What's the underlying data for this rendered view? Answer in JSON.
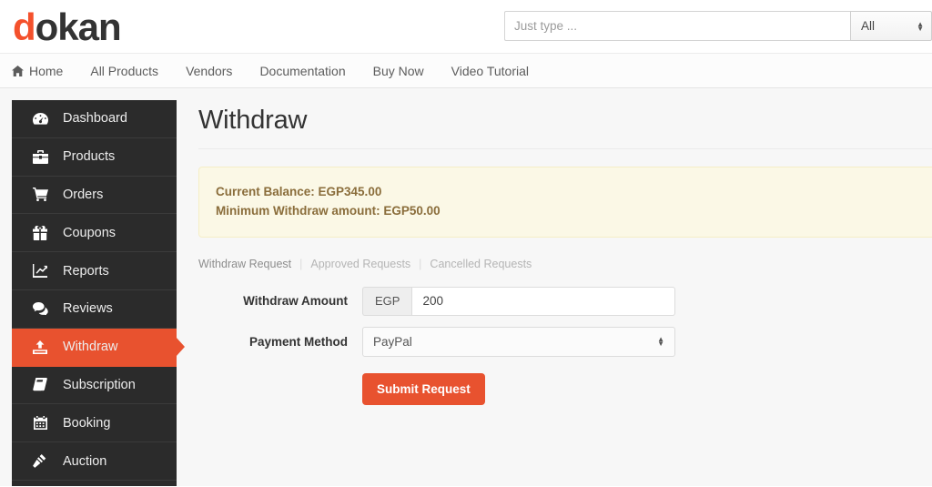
{
  "brand": {
    "logo_first": "d",
    "logo_rest": "okan",
    "accent_color": "#e8522f",
    "dark_color": "#2b2b2b"
  },
  "search": {
    "placeholder": "Just type ...",
    "value": "",
    "scope_selected": "All",
    "scope_icon": "updown-chevron-icon"
  },
  "nav": {
    "items": [
      {
        "label": "Home",
        "icon": "home-icon"
      },
      {
        "label": "All Products",
        "icon": ""
      },
      {
        "label": "Vendors",
        "icon": ""
      },
      {
        "label": "Documentation",
        "icon": ""
      },
      {
        "label": "Buy Now",
        "icon": ""
      },
      {
        "label": "Video Tutorial",
        "icon": ""
      }
    ]
  },
  "sidebar": {
    "items": [
      {
        "label": "Dashboard",
        "icon": "dashboard-icon",
        "active": false
      },
      {
        "label": "Products",
        "icon": "briefcase-icon",
        "active": false
      },
      {
        "label": "Orders",
        "icon": "cart-icon",
        "active": false
      },
      {
        "label": "Coupons",
        "icon": "gift-icon",
        "active": false
      },
      {
        "label": "Reports",
        "icon": "line-chart-icon",
        "active": false
      },
      {
        "label": "Reviews",
        "icon": "comments-icon",
        "active": false
      },
      {
        "label": "Withdraw",
        "icon": "upload-icon",
        "active": true
      },
      {
        "label": "Subscription",
        "icon": "book-icon",
        "active": false
      },
      {
        "label": "Booking",
        "icon": "calendar-icon",
        "active": false
      },
      {
        "label": "Auction",
        "icon": "gavel-icon",
        "active": false
      }
    ]
  },
  "main": {
    "title": "Withdraw",
    "notice": {
      "line1": "Current Balance: EGP345.00",
      "line2": "Minimum Withdraw amount: EGP50.00"
    },
    "subnav": [
      {
        "label": "Withdraw Request"
      },
      {
        "label": "Approved Requests"
      },
      {
        "label": "Cancelled Requests"
      }
    ],
    "separator": "|",
    "form": {
      "amount_label": "Withdraw Amount",
      "currency_addon": "EGP",
      "amount_value": "200",
      "amount_placeholder": "",
      "method_label": "Payment Method",
      "method_selected": "PayPal",
      "submit_label": "Submit Request"
    }
  }
}
